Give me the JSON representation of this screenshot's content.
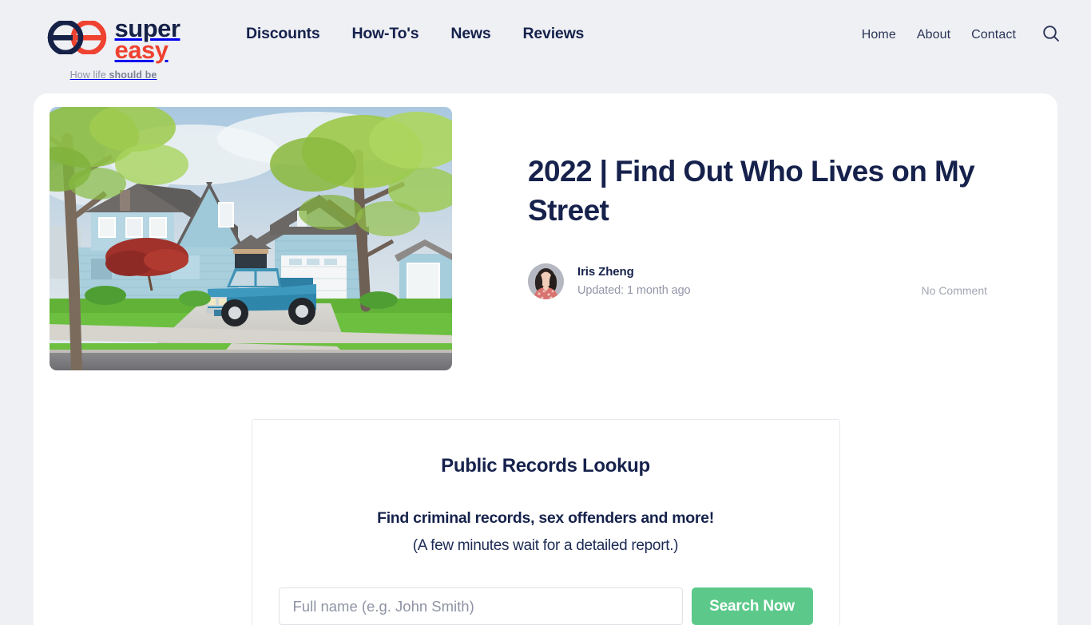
{
  "header": {
    "brand": {
      "word_super": "super",
      "word_easy": "easy",
      "tagline_light": "How life ",
      "tagline_bold": "should be",
      "logo_icon": "double-e-logo-icon",
      "colors": {
        "navy": "#152147",
        "red": "#ef4230"
      }
    },
    "main_nav": [
      {
        "label": "Discounts"
      },
      {
        "label": "How-To's"
      },
      {
        "label": "News"
      },
      {
        "label": "Reviews"
      }
    ],
    "util_nav": [
      {
        "label": "Home"
      },
      {
        "label": "About"
      },
      {
        "label": "Contact"
      }
    ],
    "search_icon": "search-icon"
  },
  "article": {
    "title": "2022 | Find Out Who Lives on My Street",
    "hero_image_alt": "light blue suburban house with a blue pickup truck parked in the driveway",
    "author": "Iris Zheng",
    "updated": "Updated: 1 month ago",
    "comments": "No Comment"
  },
  "lookup": {
    "title": "Public Records Lookup",
    "subtitle": "Find criminal records, sex offenders and more!",
    "note": "(A few minutes wait for a detailed report.)",
    "input_placeholder": "Full name (e.g. John Smith)",
    "input_value": "",
    "button_label": "Search Now",
    "button_color": "#5cc98a"
  },
  "theme": {
    "page_background": "#eff0f4",
    "card_background": "#ffffff",
    "text_navy": "#16224c",
    "muted": "#9296a8"
  }
}
